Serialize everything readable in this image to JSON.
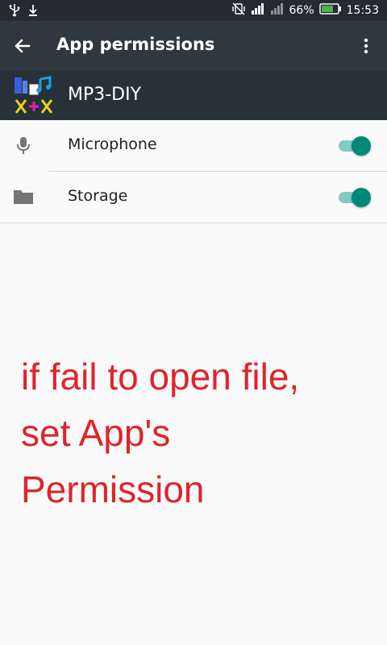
{
  "status_bar": {
    "battery_percent": "66%",
    "time": "15:53"
  },
  "app_bar": {
    "title": "App permissions"
  },
  "app": {
    "name": "MP3-DIY"
  },
  "permissions": [
    {
      "label": "Microphone",
      "icon": "microphone-icon",
      "enabled": true
    },
    {
      "label": "Storage",
      "icon": "folder-icon",
      "enabled": true
    }
  ],
  "annotation": {
    "lines": [
      "if fail to open file,",
      "set App's",
      "Permission"
    ],
    "color": "#e0232a"
  },
  "colors": {
    "status_bar": "#232b30",
    "app_bar": "#2e383e",
    "toggle_on": "#00897b",
    "toggle_track": "#80cbc4"
  }
}
